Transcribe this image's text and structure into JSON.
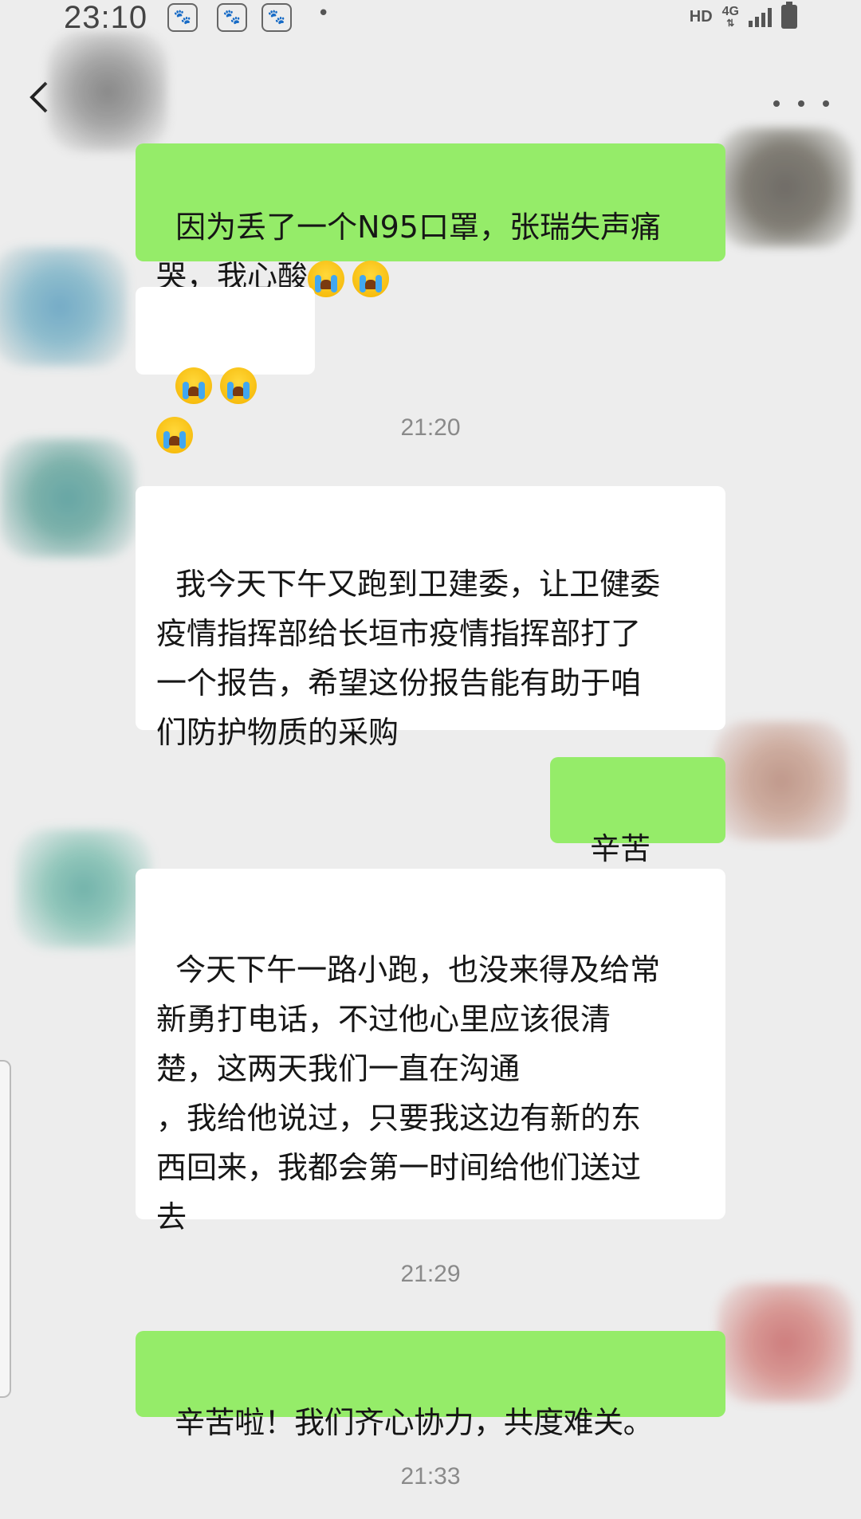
{
  "status_bar": {
    "time": "23:10",
    "network_type": "4G",
    "hd_label": "HD",
    "notification_icons": [
      "baidu-paw-icon",
      "baidu-paw-icon",
      "baidu-paw-icon"
    ]
  },
  "nav": {
    "back_icon": "chevron-left-icon",
    "more_icon": "ellipsis-icon"
  },
  "messages": [
    {
      "type": "out",
      "text": "因为丢了一个N95口罩，张瑞失声痛\n哭，我心酸",
      "emoji_count": 2
    },
    {
      "type": "in",
      "text": "",
      "emoji_count": 3
    },
    {
      "type": "time",
      "text": "21:20"
    },
    {
      "type": "in",
      "text": "我今天下午又跑到卫建委，让卫健委\n疫情指挥部给长垣市疫情指挥部打了\n一个报告，希望这份报告能有助于咱\n们防护物质的采购"
    },
    {
      "type": "out",
      "text": "辛苦啦！"
    },
    {
      "type": "in",
      "text": "今天下午一路小跑，也没来得及给常\n新勇打电话，不过他心里应该很清\n楚，这两天我们一直在沟通\n，我给他说过，只要我这边有新的东\n西回来，我都会第一时间给他们送过\n去"
    },
    {
      "type": "time",
      "text": "21:29"
    },
    {
      "type": "out",
      "text": "辛苦啦！我们齐心协力，共度难关。"
    },
    {
      "type": "time",
      "text": "21:33"
    }
  ],
  "colors": {
    "background": "#ededed",
    "outgoing_bubble": "#95ec69",
    "incoming_bubble": "#ffffff",
    "timestamp": "#8a8a8a"
  }
}
